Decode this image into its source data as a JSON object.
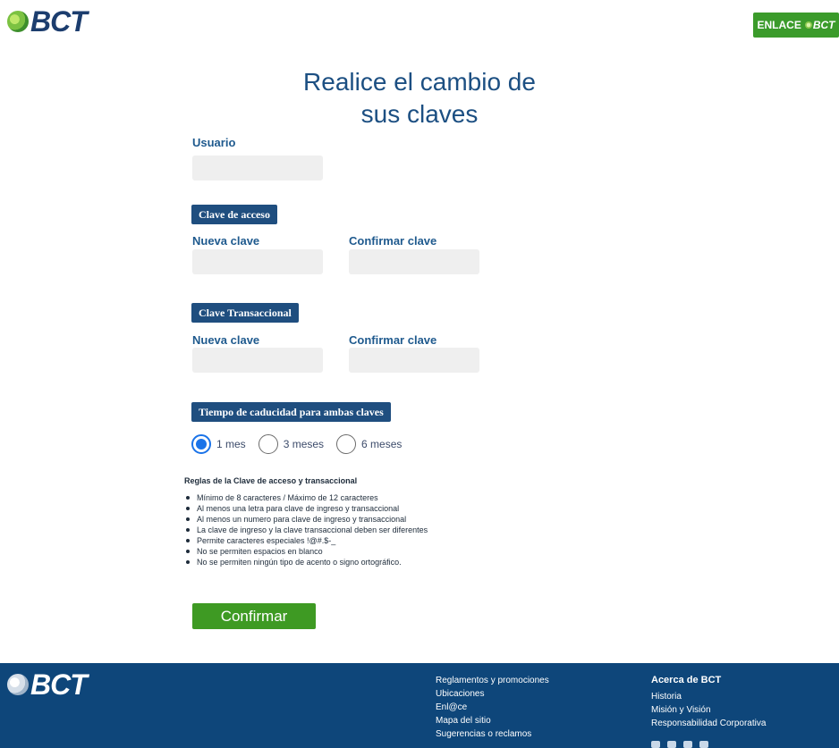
{
  "header": {
    "logo_text": "BCT",
    "enlace_label": "ENLACE",
    "enlace_brand": "BCT"
  },
  "title": {
    "line1": "Realice el cambio de",
    "line2": "sus claves"
  },
  "form": {
    "usuario_label": "Usuario",
    "clave_acceso_section": "Clave de acceso",
    "clave_transaccional_section": "Clave Transaccional",
    "nueva_clave_label": "Nueva clave",
    "confirmar_clave_label": "Confirmar clave",
    "caducidad_section": "Tiempo de caducidad para ambas claves",
    "radio_options": [
      "1 mes",
      "3 meses",
      "6 meses"
    ],
    "selected_option": "1 mes"
  },
  "rules": {
    "title": "Reglas de la Clave de acceso y transaccional",
    "items": [
      "Mínimo de 8 caracteres / Máximo de 12 caracteres",
      "Al menos una letra para clave de ingreso y transaccional",
      "Al menos un numero para clave de ingreso y transaccional",
      "La clave de ingreso y la clave transaccional deben ser diferentes",
      "Permite caracteres especiales !@#.$-_",
      "No se permiten espacios en blanco",
      "No se permiten ningún tipo de acento o signo ortográfico."
    ]
  },
  "confirm_label": "Confirmar",
  "footer": {
    "logo_text": "BCT",
    "links": [
      "Reglamentos y promociones",
      "Ubicaciones",
      "Enl@ce",
      "Mapa del sitio",
      "Sugerencias o reclamos"
    ],
    "about_title": "Acerca de BCT",
    "about_links": [
      "Historia",
      "Misión y Visión",
      "Responsabilidad Corporativa"
    ],
    "social_icons": [
      "instagram-icon",
      "linkedin-icon",
      "facebook-icon",
      "youtube-icon"
    ]
  },
  "colors": {
    "brand_blue": "#1c4f82",
    "brand_green": "#3e9a23",
    "footer_blue": "#0e467a"
  }
}
